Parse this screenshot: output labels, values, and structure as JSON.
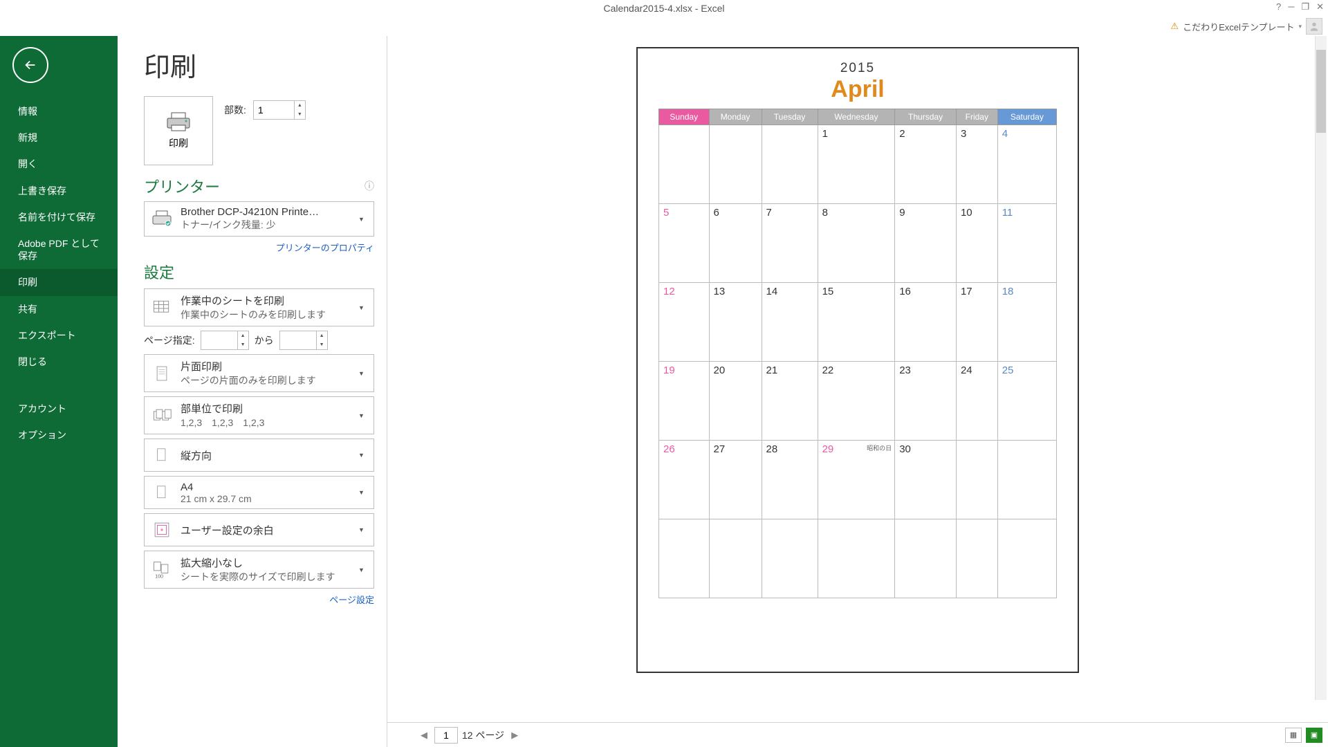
{
  "title": "Calendar2015-4.xlsx - Excel",
  "user_label": "こだわりExcelテンプレート",
  "sidebar": {
    "items": [
      {
        "label": "情報"
      },
      {
        "label": "新規"
      },
      {
        "label": "開く"
      },
      {
        "label": "上書き保存"
      },
      {
        "label": "名前を付けて保存"
      },
      {
        "label": "Adobe PDF として保存"
      },
      {
        "label": "印刷"
      },
      {
        "label": "共有"
      },
      {
        "label": "エクスポート"
      },
      {
        "label": "閉じる"
      },
      {
        "label": "アカウント"
      },
      {
        "label": "オプション"
      }
    ],
    "active_index": 6
  },
  "print": {
    "page_title": "印刷",
    "print_button": "印刷",
    "copies_label": "部数:",
    "copies_value": "1",
    "printer_section": "プリンター",
    "printer_name": "Brother DCP-J4210N Printe…",
    "printer_status": "トナー/インク残量: 少",
    "printer_props_link": "プリンターのプロパティ",
    "settings_section": "設定",
    "settings": {
      "active_sheets": {
        "t1": "作業中のシートを印刷",
        "t2": "作業中のシートのみを印刷します"
      },
      "page_range_label": "ページ指定:",
      "page_from": "",
      "page_to_label": "から",
      "page_to": "",
      "duplex": {
        "t1": "片面印刷",
        "t2": "ページの片面のみを印刷します"
      },
      "collate": {
        "t1": "部単位で印刷",
        "t2": "1,2,3　1,2,3　1,2,3"
      },
      "orientation": {
        "t1": "縦方向"
      },
      "paper": {
        "t1": "A4",
        "t2": "21 cm x 29.7 cm"
      },
      "margins": {
        "t1": "ユーザー設定の余白"
      },
      "scaling": {
        "t1": "拡大縮小なし",
        "t2": "シートを実際のサイズで印刷します"
      }
    },
    "page_setup_link": "ページ設定"
  },
  "preview": {
    "year": "2015",
    "month": "April",
    "days": [
      "Sunday",
      "Monday",
      "Tuesday",
      "Wednesday",
      "Thursday",
      "Friday",
      "Saturday"
    ],
    "weeks": [
      [
        {
          "d": ""
        },
        {
          "d": ""
        },
        {
          "d": ""
        },
        {
          "d": "1"
        },
        {
          "d": "2"
        },
        {
          "d": "3"
        },
        {
          "d": "4"
        }
      ],
      [
        {
          "d": "5"
        },
        {
          "d": "6"
        },
        {
          "d": "7"
        },
        {
          "d": "8"
        },
        {
          "d": "9"
        },
        {
          "d": "10"
        },
        {
          "d": "11"
        }
      ],
      [
        {
          "d": "12"
        },
        {
          "d": "13"
        },
        {
          "d": "14"
        },
        {
          "d": "15"
        },
        {
          "d": "16"
        },
        {
          "d": "17"
        },
        {
          "d": "18"
        }
      ],
      [
        {
          "d": "19"
        },
        {
          "d": "20"
        },
        {
          "d": "21"
        },
        {
          "d": "22"
        },
        {
          "d": "23"
        },
        {
          "d": "24"
        },
        {
          "d": "25"
        }
      ],
      [
        {
          "d": "26"
        },
        {
          "d": "27"
        },
        {
          "d": "28"
        },
        {
          "d": "29",
          "hol": true,
          "note": "昭和の日"
        },
        {
          "d": "30"
        },
        {
          "d": ""
        },
        {
          "d": ""
        }
      ],
      [
        {
          "d": ""
        },
        {
          "d": ""
        },
        {
          "d": ""
        },
        {
          "d": ""
        },
        {
          "d": ""
        },
        {
          "d": ""
        },
        {
          "d": ""
        }
      ]
    ],
    "pager": {
      "current": "1",
      "total": "12",
      "suffix": "ページ"
    }
  }
}
